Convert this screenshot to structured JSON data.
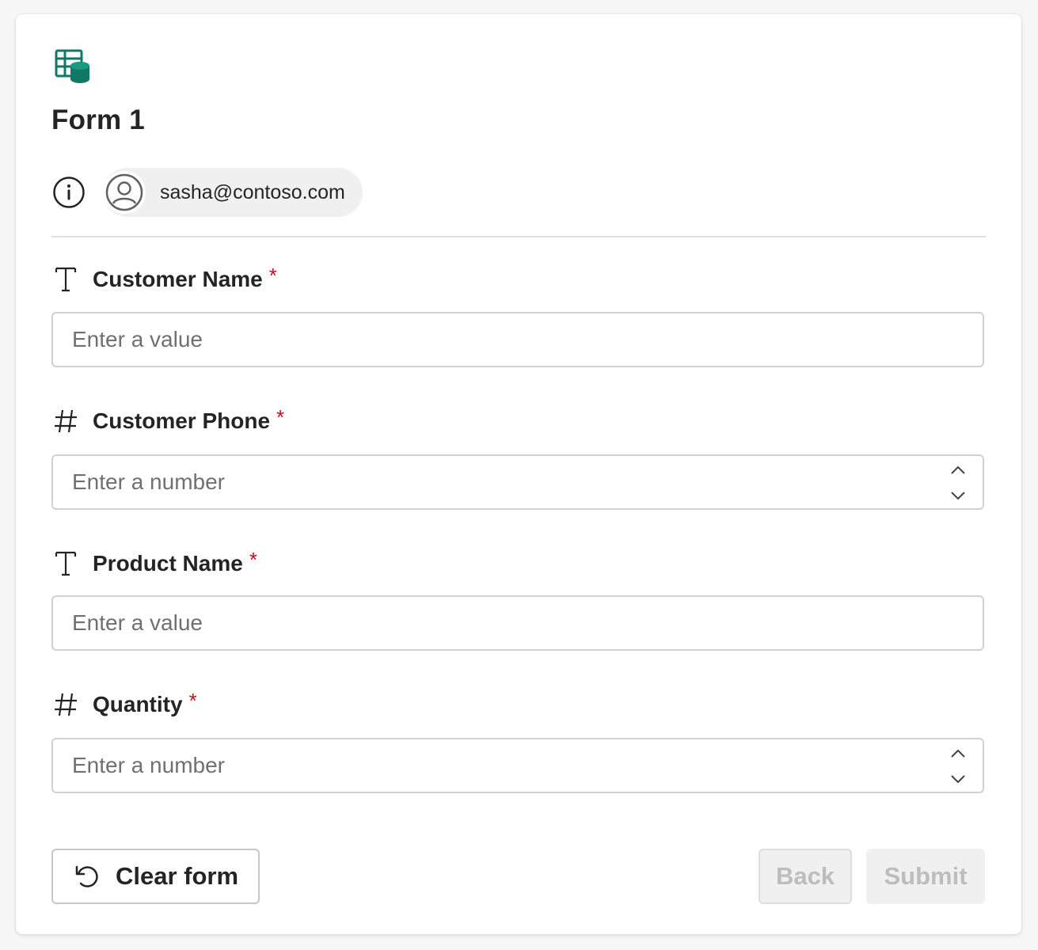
{
  "form": {
    "title": "Form 1",
    "user_email": "sasha@contoso.com",
    "accent_color": "#117865",
    "required_color": "#c50f1f"
  },
  "fields": [
    {
      "label": "Customer Name",
      "type_icon": "text-type-icon",
      "required_mark": "*",
      "placeholder": "Enter a value",
      "value": ""
    },
    {
      "label": "Customer Phone",
      "type_icon": "number-type-icon",
      "required_mark": "*",
      "placeholder": "Enter a number",
      "value": ""
    },
    {
      "label": "Product Name",
      "type_icon": "text-type-icon",
      "required_mark": "*",
      "placeholder": "Enter a value",
      "value": ""
    },
    {
      "label": "Quantity",
      "type_icon": "number-type-icon",
      "required_mark": "*",
      "placeholder": "Enter a number",
      "value": ""
    }
  ],
  "actions": {
    "clear_label": "Clear form",
    "back_label": "Back",
    "submit_label": "Submit"
  }
}
